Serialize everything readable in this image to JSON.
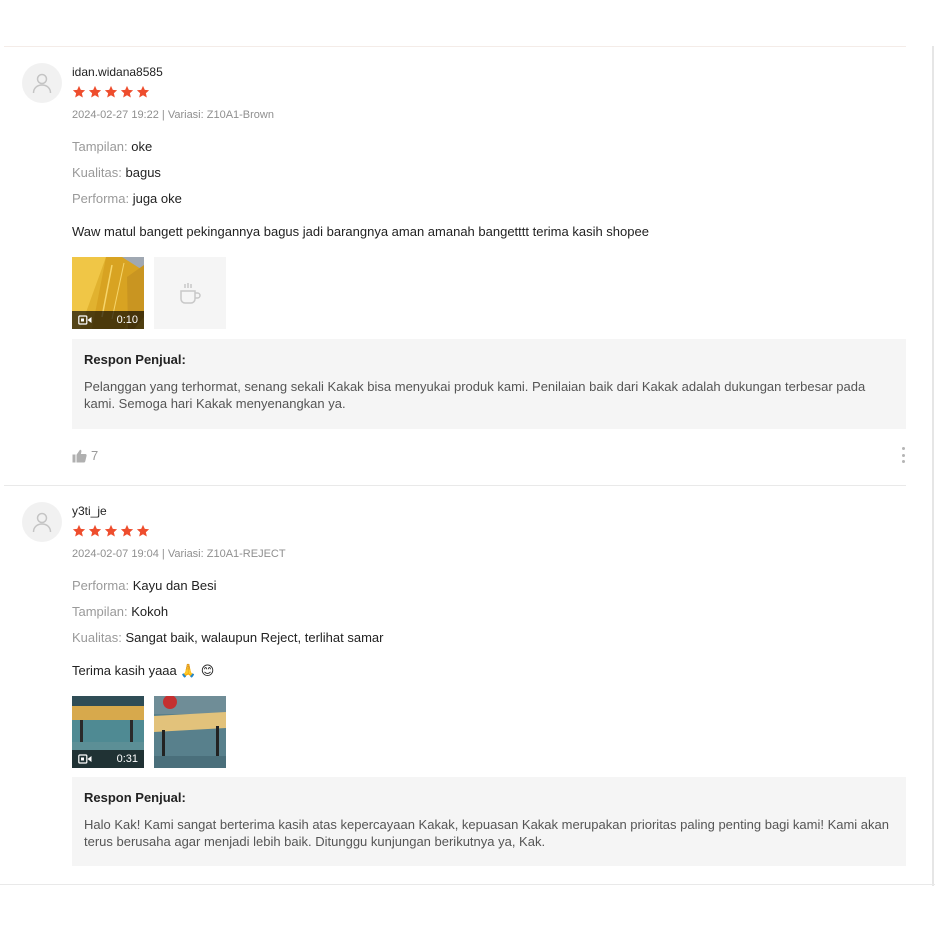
{
  "reviews": [
    {
      "username": "idan.widana8585",
      "rating": 5,
      "meta": "2024-02-27 19:22 | Variasi: Z10A1-Brown",
      "fields": [
        {
          "key": "Tampilan:",
          "value": "oke"
        },
        {
          "key": "Kualitas:",
          "value": "bagus"
        },
        {
          "key": "Performa:",
          "value": "juga oke"
        }
      ],
      "comment": "Waw matul bangett pekingannya bagus jadi barangnya aman amanah bangetttt terima kasih shopee",
      "media": [
        {
          "type": "video",
          "duration": "0:10"
        },
        {
          "type": "placeholder-image"
        }
      ],
      "reply": {
        "title": "Respon Penjual:",
        "text": "Pelanggan yang terhormat, senang sekali Kakak bisa menyukai produk kami. Penilaian baik dari Kakak adalah dukungan terbesar pada kami. Semoga hari Kakak menyenangkan ya."
      },
      "likes": "7"
    },
    {
      "username": "y3ti_je",
      "rating": 5,
      "meta": "2024-02-07 19:04 | Variasi: Z10A1-REJECT",
      "fields": [
        {
          "key": "Performa:",
          "value": "Kayu dan Besi"
        },
        {
          "key": "Tampilan:",
          "value": "Kokoh"
        },
        {
          "key": "Kualitas:",
          "value": "Sangat baik, walaupun Reject, terlihat samar"
        }
      ],
      "comment": "Terima kasih yaaa",
      "comment_emojis": "🙏 😊",
      "media": [
        {
          "type": "video",
          "duration": "0:31"
        },
        {
          "type": "image"
        }
      ],
      "reply": {
        "title": "Respon Penjual:",
        "text": "Halo Kak! Kami sangat berterima kasih atas kepercayaan Kakak, kepuasan Kakak merupakan prioritas paling penting bagi kami! Kami akan terus berusaha agar menjadi lebih baik. Ditunggu kunjungan berikutnya ya, Kak."
      }
    }
  ],
  "colors": {
    "star": "#ee4d2d",
    "muted_text": "#9a9a9a",
    "reply_bg": "#f5f5f5"
  }
}
